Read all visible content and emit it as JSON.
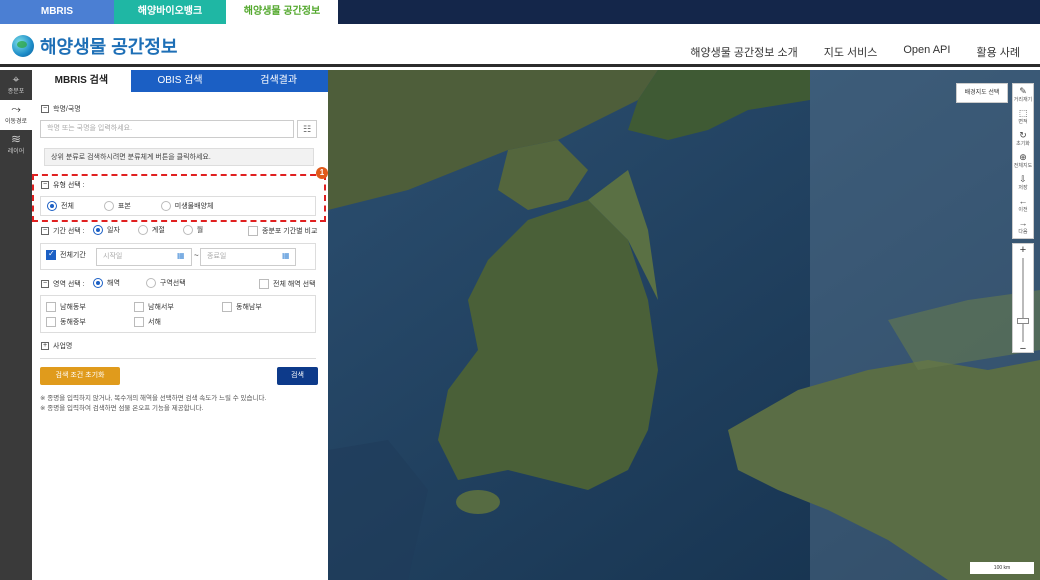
{
  "top_tabs": [
    "MBRIS",
    "해양바이오뱅크",
    "해양생물 공간정보"
  ],
  "header": {
    "logo_text": "해양생물 공간정보",
    "nav": [
      "해양생물 공간정보 소개",
      "지도 서비스",
      "Open API",
      "활용 사례"
    ]
  },
  "left_rail": [
    "종분포",
    "이동경로",
    "레이어"
  ],
  "panel": {
    "tabs": [
      "MBRIS 검색",
      "OBIS 검색",
      "검색결과"
    ],
    "sci_name_title": "학명/국명",
    "sci_name_placeholder": "학명 또는 국명을 입력하세요.",
    "classify_info": "상위 분류로 검색하시려면 분류체계 버튼을 클릭하세요.",
    "type_title": "유형 선택 :",
    "type_options": [
      "전체",
      "표본",
      "미생물배양체"
    ],
    "period_title": "기간 선택 :",
    "period_options": [
      "일자",
      "계절",
      "월"
    ],
    "period_compare": "종분포 기간별 비교",
    "all_period": "전체기간",
    "start_placeholder": "시작일",
    "end_placeholder": "종료일",
    "range_sep": "~",
    "area_title": "영역 선택 :",
    "area_options": [
      "해역",
      "구역선택"
    ],
    "all_sea": "전체 해역 선택",
    "regions": [
      "남해동부",
      "남해서부",
      "동해남부",
      "동해중부",
      "서해"
    ],
    "project_title": "사업명",
    "reset_button": "검색 조건 초기화",
    "search_button": "검색",
    "notes": [
      "※ 종명을 입력하지 않거나, 복수개의 해역을 선택하면 검색 속도가 느릴 수 있습니다.",
      "※ 종명을 입력하여 검색하면 섬물 온오프 기능을 제공합니다."
    ],
    "badge": "1"
  },
  "map": {
    "bg_button": "배경지도 선택",
    "tools": [
      "거리재기",
      "면적",
      "초기화",
      "전체지도",
      "저장",
      "이전",
      "다음"
    ],
    "scale": "100 km"
  }
}
